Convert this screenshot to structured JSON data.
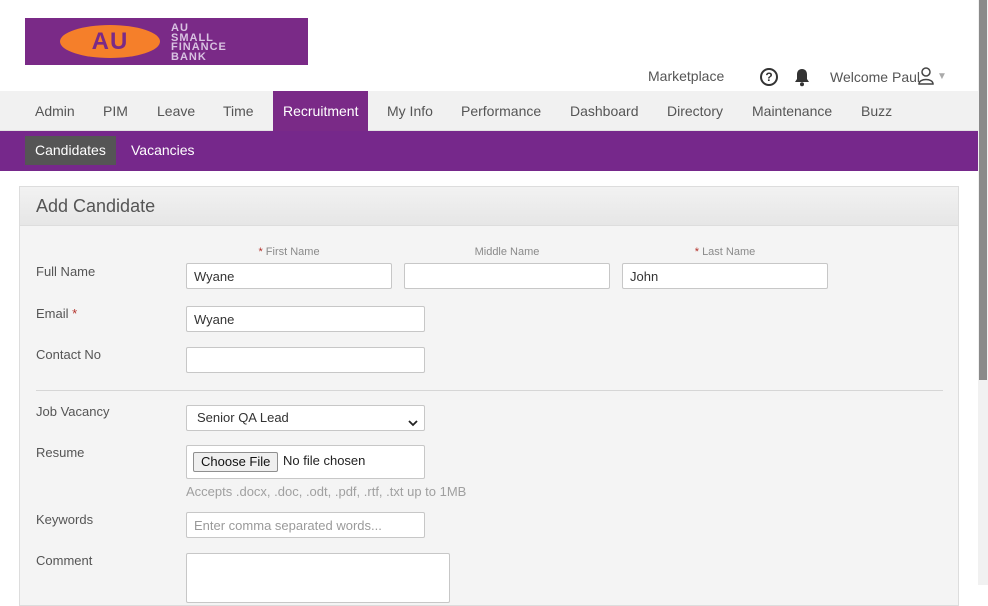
{
  "logo": {
    "mark": "AU",
    "lines": [
      "AU",
      "SMALL",
      "FINANCE",
      "BANK"
    ]
  },
  "header": {
    "marketplace": "Marketplace",
    "help_glyph": "?",
    "welcome": "Welcome Paul"
  },
  "nav": {
    "items": [
      "Admin",
      "PIM",
      "Leave",
      "Time",
      "Recruitment",
      "My Info",
      "Performance",
      "Dashboard",
      "Directory",
      "Maintenance",
      "Buzz"
    ],
    "active": "Recruitment"
  },
  "subnav": {
    "items": [
      "Candidates",
      "Vacancies"
    ],
    "active": "Candidates"
  },
  "form": {
    "title": "Add Candidate",
    "full_name_label": "Full Name",
    "first_name_label": "First Name",
    "middle_name_label": "Middle Name",
    "last_name_label": "Last Name",
    "required_mark": "*",
    "first_name_value": "Wyane",
    "middle_name_value": "",
    "last_name_value": "John",
    "email_label": "Email",
    "email_value": "Wyane",
    "contact_label": "Contact No",
    "contact_value": "",
    "job_vacancy_label": "Job Vacancy",
    "job_vacancy_value": "Senior QA Lead",
    "resume_label": "Resume",
    "choose_file_label": "Choose File",
    "no_file_text": "No file chosen",
    "resume_hint": "Accepts .docx, .doc, .odt, .pdf, .rtf, .txt up to 1MB",
    "keywords_label": "Keywords",
    "keywords_placeholder": "Enter comma separated words...",
    "comment_label": "Comment"
  },
  "colors": {
    "brand_purple": "#7a2a87",
    "subnav_purple": "#76288b",
    "logo_orange": "#f57f2a"
  },
  "icons": {
    "help": "help-circle-icon",
    "bell": "bell-icon",
    "user": "user-icon",
    "caret": "caret-down-icon"
  }
}
